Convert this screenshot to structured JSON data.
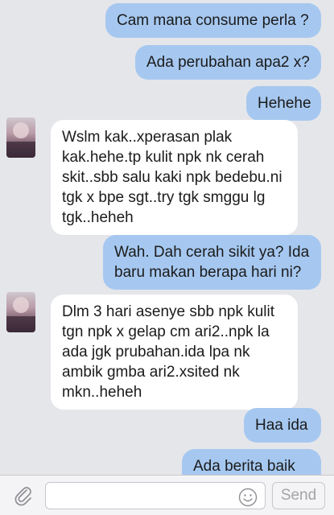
{
  "messages": [
    {
      "dir": "out",
      "text": "Cam mana consume perla ?"
    },
    {
      "dir": "out",
      "text": "Ada perubahan apa2 x?"
    },
    {
      "dir": "out",
      "text": "Hehehe"
    },
    {
      "dir": "in",
      "text": "Wslm kak..xperasan plak kak.hehe.tp kulit npk nk cerah skit..sbb salu kaki npk bedebu.ni tgk x bpe sgt..try tgk smggu lg tgk..heheh"
    },
    {
      "dir": "out",
      "text": "Wah. Dah cerah sikit ya? Ida baru makan berapa hari ni?"
    },
    {
      "dir": "in",
      "text": "Dlm 3 hari asenye  sbb npk kulit tgn npk x gelap cm ari2..npk la ada jgk prubahan.ida lpa nk ambik gmba ari2.xsited nk mkn..heheh"
    },
    {
      "dir": "out",
      "text": "Haa ida"
    },
    {
      "dir": "out",
      "text": "Ada berita baik ni"
    }
  ],
  "input": {
    "placeholder": "",
    "send_label": "Send",
    "attach_icon": "paperclip-icon",
    "emoji_icon": "smiley-icon"
  },
  "colors": {
    "background": "#e5e6ea",
    "outgoing_bubble": "#a6c8f0",
    "incoming_bubble": "#ffffff"
  }
}
